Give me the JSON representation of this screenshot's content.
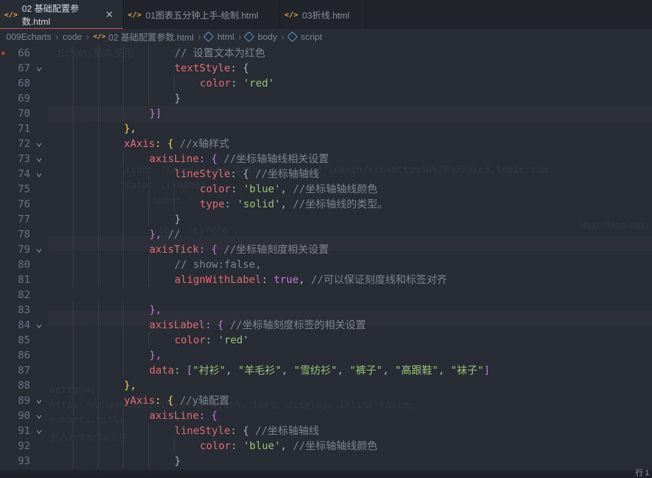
{
  "tabs": [
    {
      "label": "02 基础配置参数.html",
      "active": true,
      "closable": true,
      "icon": "code-icon"
    },
    {
      "label": "01图表五分钟上手-绘制.html",
      "active": false,
      "closable": false,
      "icon": "code-icon"
    },
    {
      "label": "03折线.html",
      "active": false,
      "closable": false,
      "icon": "code-icon"
    }
  ],
  "breadcrumb": [
    "009Echarts",
    "code",
    "02 基础配置参数.html",
    "html",
    "body",
    "script"
  ],
  "ghost": {
    "heading": "Echarts基本使用",
    "url": "icon: 'image://www.baidu.com/image_search/src=http%3A%2F%2Fpic3.16pic.com",
    "data_row": "data: [{'name'",
    "name_row": "name: '",
    "icon_row": "icon: 'circle',",
    "watermark": "https://blog.csdn",
    "bottom_a": "option={",
    "bottom_b": "https://zhuanlan.zhihu.com/ width: 100%; display: inline-table;",
    "bottom_c": "echarts.title",
    "bottom_d": "引入echarts文件"
  },
  "code_lines": [
    {
      "n": "66",
      "fold": false,
      "bp": true,
      "indent": 5,
      "tokens": [
        {
          "t": "cmt",
          "v": "// 设置文本为红色"
        }
      ]
    },
    {
      "n": "67",
      "fold": true,
      "indent": 5,
      "tokens": [
        {
          "t": "prop",
          "v": "textStyle"
        },
        {
          "t": "p",
          "v": ": "
        },
        {
          "t": "p",
          "v": "{"
        }
      ]
    },
    {
      "n": "68",
      "fold": false,
      "indent": 6,
      "tokens": [
        {
          "t": "prop",
          "v": "color"
        },
        {
          "t": "p",
          "v": ": "
        },
        {
          "t": "str",
          "v": "'red'"
        }
      ]
    },
    {
      "n": "69",
      "fold": false,
      "indent": 5,
      "tokens": [
        {
          "t": "p",
          "v": "}"
        }
      ]
    },
    {
      "n": "70",
      "fold": false,
      "indent": 4,
      "tokens": [
        {
          "t": "p",
          "v": "}]"
        }
      ]
    },
    {
      "n": "71",
      "fold": false,
      "indent": 3,
      "tokens": [
        {
          "t": "p",
          "v": "},"
        }
      ]
    },
    {
      "n": "72",
      "fold": true,
      "indent": 3,
      "tokens": [
        {
          "t": "prop",
          "v": "xAxis"
        },
        {
          "t": "p",
          "v": ": { "
        },
        {
          "t": "cmt",
          "v": "//x轴样式"
        }
      ]
    },
    {
      "n": "73",
      "fold": true,
      "indent": 4,
      "tokens": [
        {
          "t": "prop",
          "v": "axisLine"
        },
        {
          "t": "p",
          "v": ": { "
        },
        {
          "t": "cmt",
          "v": "//坐标轴轴线相关设置"
        }
      ]
    },
    {
      "n": "74",
      "fold": true,
      "indent": 5,
      "tokens": [
        {
          "t": "prop",
          "v": "lineStyle"
        },
        {
          "t": "p",
          "v": ": { "
        },
        {
          "t": "cmt",
          "v": "//坐标轴轴线"
        }
      ]
    },
    {
      "n": "75",
      "fold": false,
      "indent": 6,
      "tokens": [
        {
          "t": "prop",
          "v": "color"
        },
        {
          "t": "p",
          "v": ": "
        },
        {
          "t": "str",
          "v": "'blue'"
        },
        {
          "t": "p",
          "v": ", "
        },
        {
          "t": "cmt",
          "v": "//坐标轴轴线颜色"
        }
      ]
    },
    {
      "n": "76",
      "fold": false,
      "indent": 6,
      "tokens": [
        {
          "t": "prop",
          "v": "type"
        },
        {
          "t": "p",
          "v": ": "
        },
        {
          "t": "str",
          "v": "'solid'"
        },
        {
          "t": "p",
          "v": ", "
        },
        {
          "t": "cmt",
          "v": "//坐标轴线的类型。"
        }
      ]
    },
    {
      "n": "77",
      "fold": false,
      "indent": 5,
      "tokens": [
        {
          "t": "p",
          "v": "}"
        }
      ]
    },
    {
      "n": "78",
      "fold": false,
      "indent": 4,
      "tokens": [
        {
          "t": "p",
          "v": "}, "
        },
        {
          "t": "cmt",
          "v": "//"
        }
      ]
    },
    {
      "n": "79",
      "fold": true,
      "indent": 4,
      "tokens": [
        {
          "t": "prop",
          "v": "axisTick"
        },
        {
          "t": "p",
          "v": ": { "
        },
        {
          "t": "cmt",
          "v": "//坐标轴刻度相关设置"
        }
      ]
    },
    {
      "n": "80",
      "fold": false,
      "indent": 5,
      "tokens": [
        {
          "t": "cmt",
          "v": "// show:false,"
        }
      ]
    },
    {
      "n": "81",
      "fold": false,
      "indent": 5,
      "tokens": [
        {
          "t": "prop",
          "v": "alignWithLabel"
        },
        {
          "t": "p",
          "v": ": "
        },
        {
          "t": "kw",
          "v": "true"
        },
        {
          "t": "p",
          "v": ", "
        },
        {
          "t": "cmt",
          "v": "//可以保证刻度线和标签对齐"
        }
      ]
    },
    {
      "n": "82",
      "fold": false,
      "indent": 0,
      "tokens": []
    },
    {
      "n": "83",
      "fold": false,
      "indent": 4,
      "tokens": [
        {
          "t": "p",
          "v": "},"
        }
      ]
    },
    {
      "n": "84",
      "fold": true,
      "indent": 4,
      "tokens": [
        {
          "t": "prop",
          "v": "axisLabel"
        },
        {
          "t": "p",
          "v": ": { "
        },
        {
          "t": "cmt",
          "v": "//坐标轴刻度标签的相关设置"
        }
      ]
    },
    {
      "n": "85",
      "fold": false,
      "indent": 5,
      "tokens": [
        {
          "t": "prop",
          "v": "color"
        },
        {
          "t": "p",
          "v": ": "
        },
        {
          "t": "str",
          "v": "'red'"
        }
      ]
    },
    {
      "n": "86",
      "fold": false,
      "indent": 4,
      "tokens": [
        {
          "t": "p",
          "v": "},"
        }
      ]
    },
    {
      "n": "87",
      "fold": false,
      "indent": 4,
      "tokens": [
        {
          "t": "prop",
          "v": "data"
        },
        {
          "t": "p",
          "v": ": "
        },
        {
          "t": "p",
          "v": "["
        },
        {
          "t": "str",
          "v": "\"衬衫\""
        },
        {
          "t": "p",
          "v": ", "
        },
        {
          "t": "str",
          "v": "\"羊毛衫\""
        },
        {
          "t": "p",
          "v": ", "
        },
        {
          "t": "str",
          "v": "\"雪纺衫\""
        },
        {
          "t": "p",
          "v": ", "
        },
        {
          "t": "str",
          "v": "\"裤子\""
        },
        {
          "t": "p",
          "v": ", "
        },
        {
          "t": "str",
          "v": "\"高跟鞋\""
        },
        {
          "t": "p",
          "v": ", "
        },
        {
          "t": "str",
          "v": "\"袜子\""
        },
        {
          "t": "p",
          "v": "]"
        }
      ]
    },
    {
      "n": "88",
      "fold": false,
      "indent": 3,
      "tokens": [
        {
          "t": "p",
          "v": "},"
        }
      ]
    },
    {
      "n": "89",
      "fold": true,
      "indent": 3,
      "tokens": [
        {
          "t": "prop",
          "v": "yAxis"
        },
        {
          "t": "p",
          "v": ": { "
        },
        {
          "t": "cmt",
          "v": "//y轴配置"
        }
      ]
    },
    {
      "n": "90",
      "fold": true,
      "indent": 4,
      "tokens": [
        {
          "t": "prop",
          "v": "axisLine"
        },
        {
          "t": "p",
          "v": ": {"
        }
      ]
    },
    {
      "n": "91",
      "fold": true,
      "indent": 5,
      "tokens": [
        {
          "t": "prop",
          "v": "lineStyle"
        },
        {
          "t": "p",
          "v": ": { "
        },
        {
          "t": "cmt",
          "v": "//坐标轴轴线"
        }
      ]
    },
    {
      "n": "92",
      "fold": false,
      "indent": 6,
      "tokens": [
        {
          "t": "prop",
          "v": "color"
        },
        {
          "t": "p",
          "v": ": "
        },
        {
          "t": "str",
          "v": "'blue'"
        },
        {
          "t": "p",
          "v": ", "
        },
        {
          "t": "cmt",
          "v": "//坐标轴轴线颜色"
        }
      ]
    },
    {
      "n": "93",
      "fold": false,
      "indent": 5,
      "tokens": [
        {
          "t": "p",
          "v": "}"
        }
      ]
    }
  ],
  "status_fragment": "行 1"
}
